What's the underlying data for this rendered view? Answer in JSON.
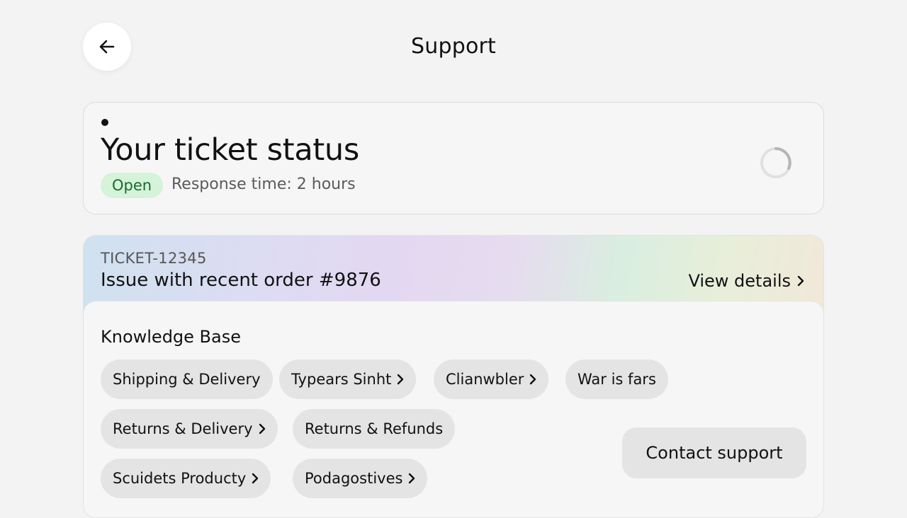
{
  "header": {
    "title": "Support",
    "back_icon": "arrow-left-icon"
  },
  "status": {
    "title": "Your ticket status",
    "badge": "Open",
    "badge_color": "#d4f3d9",
    "response_time": "Response time: 2 hours",
    "loading_icon": "spinner-icon"
  },
  "ticket": {
    "id": "TICKET-12345",
    "subject": "Issue with recent order #9876",
    "view_details": "View details"
  },
  "knowledge_base": {
    "title": "Knowledge Base",
    "topics": [
      {
        "label": "Shipping & Delivery",
        "chevron": false
      },
      {
        "label": "Typears Sinht",
        "chevron": true
      },
      {
        "label": "Clianwbler",
        "chevron": true
      },
      {
        "label": "War is fars",
        "chevron": false
      },
      {
        "label": "Returns & Delivery",
        "chevron": true
      },
      {
        "label": "Returns & Refunds",
        "chevron": false
      },
      {
        "label": "Scuidets Producty",
        "chevron": true
      },
      {
        "label": "Podagostives",
        "chevron": true
      }
    ]
  },
  "actions": {
    "contact_support": "Contact support"
  }
}
